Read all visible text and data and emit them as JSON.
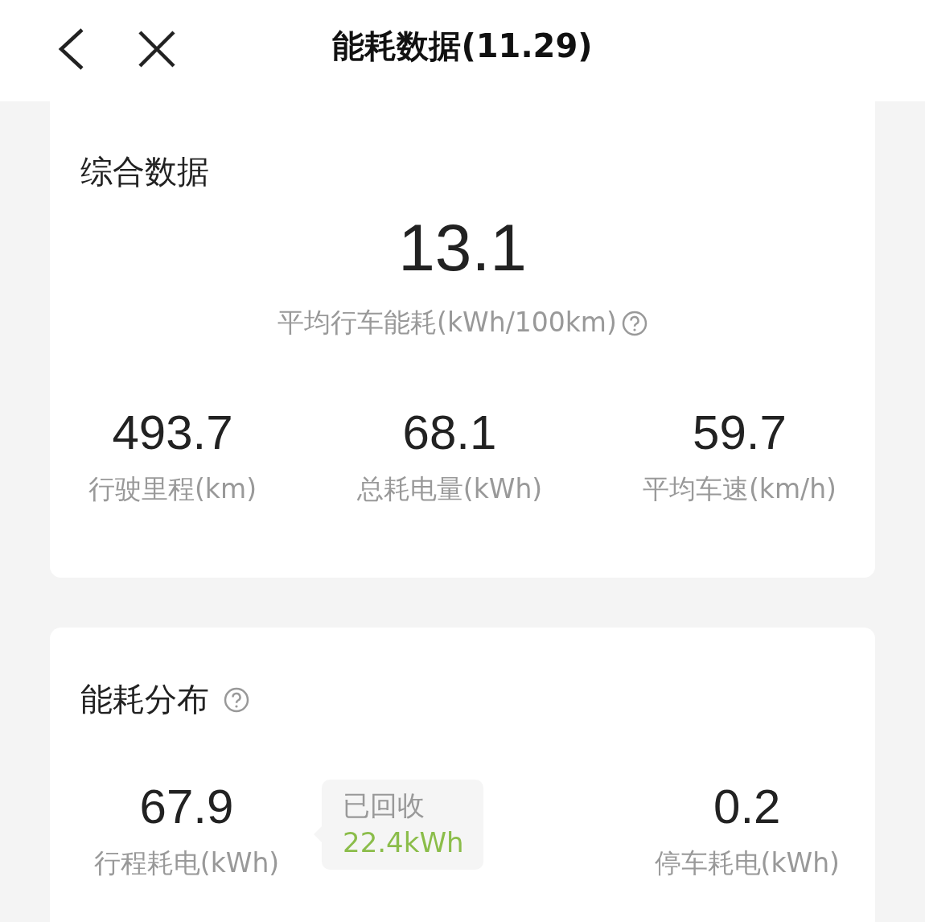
{
  "header": {
    "title": "能耗数据(11.29)"
  },
  "summary": {
    "title": "综合数据",
    "main_value": "13.1",
    "main_label": "平均行车能耗(kWh/100km)",
    "stats": [
      {
        "value": "493.7",
        "label": "行驶里程(km)"
      },
      {
        "value": "68.1",
        "label": "总耗电量(kWh)"
      },
      {
        "value": "59.7",
        "label": "平均车速(km/h)"
      }
    ]
  },
  "distribution": {
    "title": "能耗分布",
    "driving": {
      "value": "67.9",
      "label": "行程耗电(kWh)"
    },
    "recovered": {
      "label": "已回收",
      "value": "22.4kWh"
    },
    "parking": {
      "value": "0.2",
      "label": "停车耗电(kWh)"
    }
  }
}
